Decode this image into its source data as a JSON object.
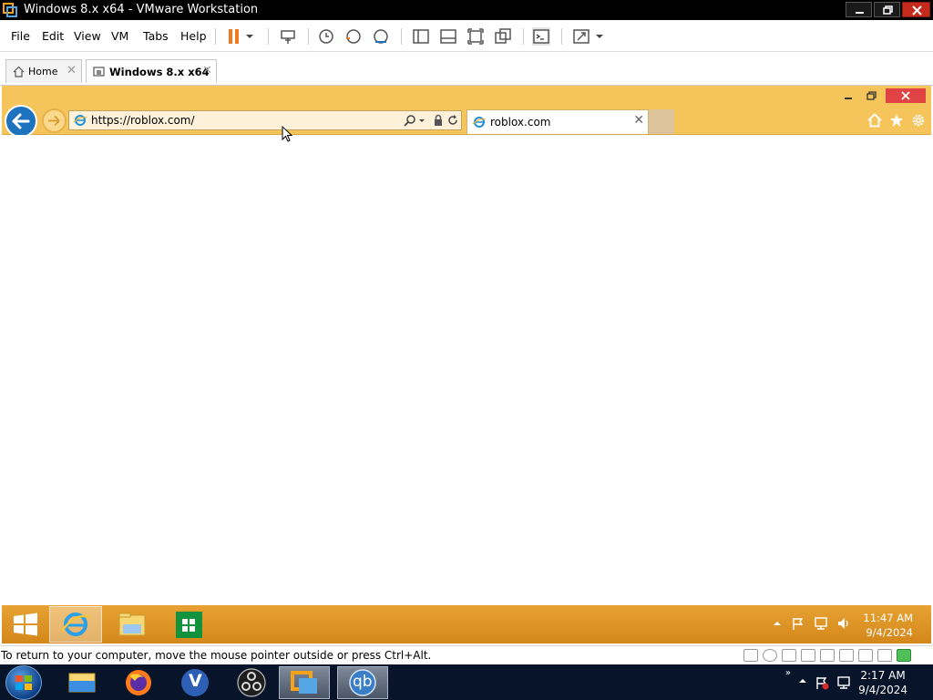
{
  "vmware": {
    "title": "Windows 8.x x64 - VMware Workstation",
    "menu": [
      "File",
      "Edit",
      "View",
      "VM",
      "Tabs",
      "Help"
    ],
    "tabs": [
      {
        "label": "Home"
      },
      {
        "label": "Windows 8.x x64"
      }
    ],
    "status_message": "To return to your computer, move the mouse pointer outside or press Ctrl+Alt."
  },
  "ie": {
    "address": "https://roblox.com/",
    "tab_title": "roblox.com"
  },
  "guest_taskbar": {
    "time": "11:47 AM",
    "date": "9/4/2024"
  },
  "host_taskbar": {
    "time": "2:17 AM",
    "date": "9/4/2024",
    "qb_label": "qb",
    "v_label": "V"
  },
  "colors": {
    "ie_frame": "#f5c45a",
    "guest_taskbar": "#e7a233",
    "host_taskbar": "#07142a"
  }
}
